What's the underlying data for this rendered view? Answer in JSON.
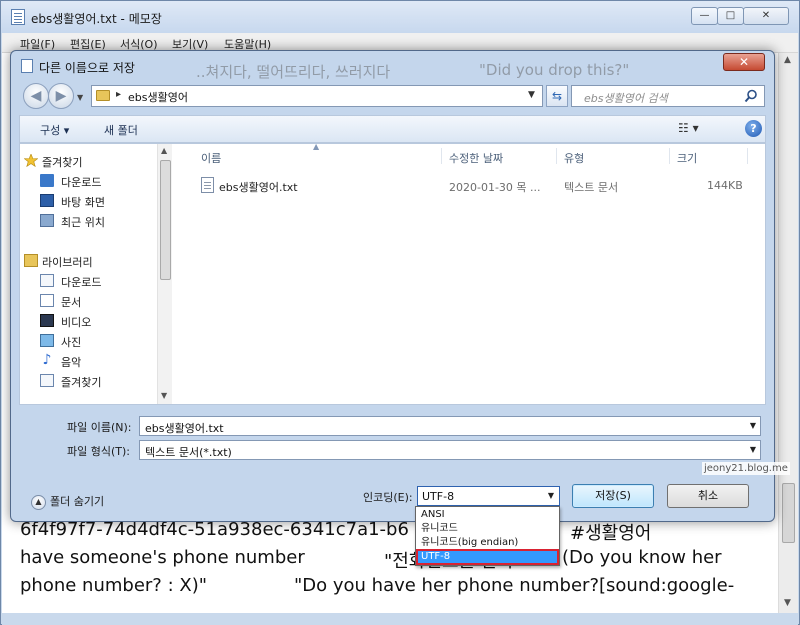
{
  "notepad": {
    "title": "ebs생활영어.txt - 메모장",
    "window_buttons": {
      "minimize": "—",
      "maximize": "□",
      "close": "✕"
    },
    "menu": [
      "파일(F)",
      "편집(E)",
      "서식(O)",
      "보기(V)",
      "도움말(H)"
    ],
    "lines": [
      "6f4f97f7-74d4df4c-51a938ec-6341c7a1-b6",
      "#생활영어",
      "have someone's phone number",
      "\"전화번호를 알다\"",
      "(Do you know her",
      "phone number? : X)\"",
      "\"Do you have her phone number?[sound:google-"
    ]
  },
  "dialog": {
    "title": "다른 이름으로 저장",
    "ghost_text": [
      "..쳐지다, 떨어뜨리다, 쓰러지다",
      "\"Did you drop this?\""
    ],
    "address": {
      "path": "ebs생활영어"
    },
    "search": {
      "placeholder": "ebs생활영어 검색"
    },
    "toolbar": {
      "organize": "구성 ▾",
      "new_folder": "새 폴더",
      "views": "☷ ▾",
      "help": "?"
    },
    "nav": {
      "favorites": {
        "label": "즐겨찾기",
        "items": [
          "다운로드",
          "바탕 화면",
          "최근 위치"
        ]
      },
      "libraries": {
        "label": "라이브러리",
        "items": [
          "다운로드",
          "문서",
          "비디오",
          "사진",
          "음악",
          "즐겨찾기"
        ]
      }
    },
    "columns": {
      "name": "이름",
      "modified": "수정한 날짜",
      "type": "유형",
      "size": "크기"
    },
    "files": [
      {
        "name": "ebs생활영어.txt",
        "modified": "2020-01-30 목 ...",
        "type": "텍스트 문서",
        "size": "144KB"
      }
    ],
    "filename": {
      "label": "파일 이름(N):",
      "value": "ebs생활영어.txt"
    },
    "filetype": {
      "label": "파일 형식(T):",
      "value": "텍스트 문서(*.txt)"
    },
    "hide_folders": "폴더 숨기기",
    "encoding": {
      "label": "인코딩(E):",
      "value": "UTF-8",
      "options": [
        "ANSI",
        "유니코드",
        "유니코드(big endian)",
        "UTF-8"
      ],
      "selected_index": 3
    },
    "save_button": "저장(S)",
    "cancel_button": "취소"
  },
  "watermark": "jeony21.blog.me",
  "colors": {
    "accent": "#3399ff",
    "highlight_outline": "#d92232",
    "window_frame": "#c4d6ec"
  }
}
